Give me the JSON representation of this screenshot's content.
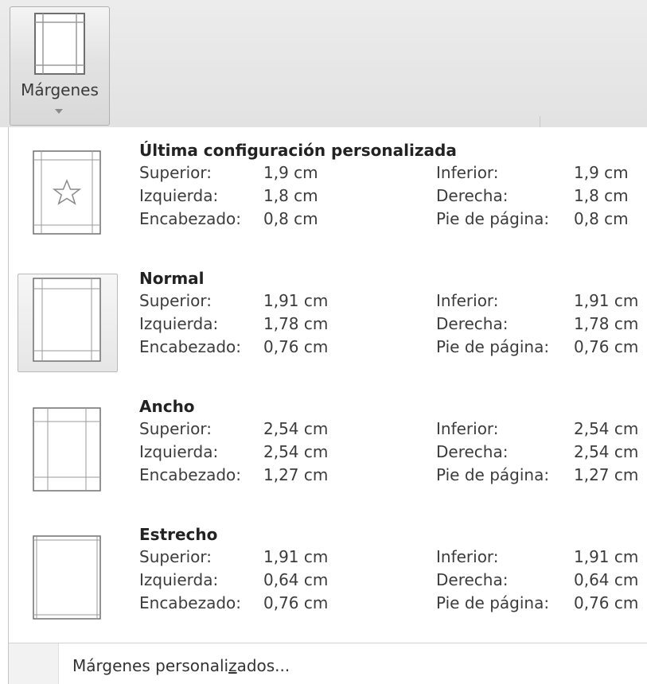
{
  "ribbon": {
    "button_label": "Márgenes",
    "icon": "page-margins-icon"
  },
  "presets": [
    {
      "name": "Última configuración personalizada",
      "icon": "star-page-icon",
      "superior_label": "Superior:",
      "superior": "1,9 cm",
      "inferior_label": "Inferior:",
      "inferior": "1,9 cm",
      "izquierda_label": "Izquierda:",
      "izquierda": "1,8 cm",
      "derecha_label": "Derecha:",
      "derecha": "1,8 cm",
      "encabezado_label": "Encabezado:",
      "encabezado": "0,8 cm",
      "pie_label": "Pie de página:",
      "pie": "0,8 cm"
    },
    {
      "name": "Normal",
      "selected": true,
      "superior_label": "Superior:",
      "superior": "1,91 cm",
      "inferior_label": "Inferior:",
      "inferior": "1,91 cm",
      "izquierda_label": "Izquierda:",
      "izquierda": "1,78 cm",
      "derecha_label": "Derecha:",
      "derecha": "1,78 cm",
      "encabezado_label": "Encabezado:",
      "encabezado": "0,76 cm",
      "pie_label": "Pie de página:",
      "pie": "0,76 cm"
    },
    {
      "name": "Ancho",
      "superior_label": "Superior:",
      "superior": "2,54 cm",
      "inferior_label": "Inferior:",
      "inferior": "2,54 cm",
      "izquierda_label": "Izquierda:",
      "izquierda": "2,54 cm",
      "derecha_label": "Derecha:",
      "derecha": "2,54 cm",
      "encabezado_label": "Encabezado:",
      "encabezado": "1,27 cm",
      "pie_label": "Pie de página:",
      "pie": "1,27 cm"
    },
    {
      "name": "Estrecho",
      "superior_label": "Superior:",
      "superior": "1,91 cm",
      "inferior_label": "Inferior:",
      "inferior": "1,91 cm",
      "izquierda_label": "Izquierda:",
      "izquierda": "0,64 cm",
      "derecha_label": "Derecha:",
      "derecha": "0,64 cm",
      "encabezado_label": "Encabezado:",
      "encabezado": "0,76 cm",
      "pie_label": "Pie de página:",
      "pie": "0,76 cm"
    }
  ],
  "footer": {
    "custom_before": "Márgenes personali",
    "custom_access_key": "z",
    "custom_after": "ados..."
  }
}
